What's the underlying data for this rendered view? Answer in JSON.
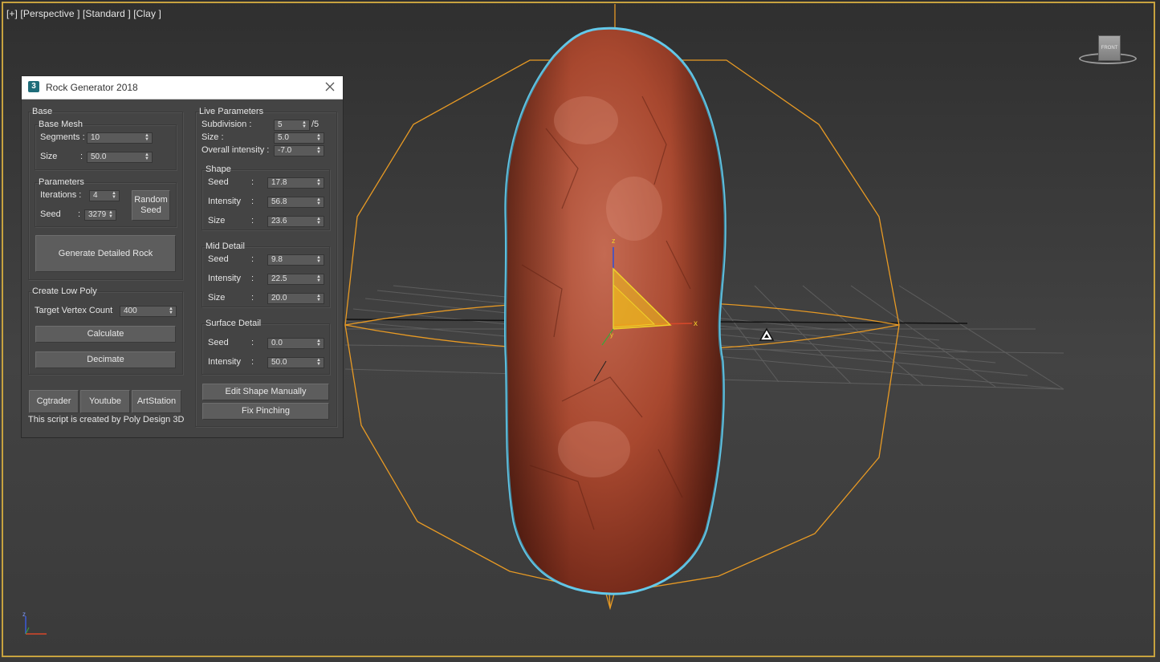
{
  "viewport": {
    "label_items": [
      "[+]",
      "[Perspective ]",
      "[Standard ]",
      "[Clay ]"
    ],
    "viewcube_label": "FRONT",
    "gizmo_x": "x",
    "gizmo_z": "z",
    "gizmo_y": "y",
    "tripod_z": "z",
    "colors": {
      "border": "#c7a23f",
      "selection_outline": "#63c9ea",
      "bounding_box": "#e89a24",
      "rock": "#a8482f"
    }
  },
  "dialog": {
    "title": "Rock Generator 2018",
    "base": {
      "label": "Base",
      "base_mesh": {
        "label": "Base Mesh",
        "segments_label": "Segments :",
        "segments_value": "10",
        "size_label": "Size",
        "size_colon": ":",
        "size_value": "50.0"
      },
      "parameters": {
        "label": "Parameters",
        "iterations_label": "Iterations :",
        "iterations_value": "4",
        "seed_label": "Seed",
        "seed_colon": ":",
        "seed_value": "3279",
        "random_seed_line1": "Random",
        "random_seed_line2": "Seed"
      },
      "generate_label": "Generate Detailed Rock"
    },
    "low_poly": {
      "label": "Create Low Poly",
      "target_label": "Target Vertex Count",
      "target_value": "400",
      "calculate_label": "Calculate",
      "decimate_label": "Decimate"
    },
    "links": {
      "cgtrader": "Cgtrader",
      "youtube": "Youtube",
      "artstation": "ArtStation"
    },
    "credit": "This script is created by Poly Design 3D",
    "live": {
      "label": "Live Parameters",
      "subdivision_label": "Subdivision :",
      "subdivision_value": "5",
      "subdivision_max": "/5",
      "size_label": "Size :",
      "size_value": "5.0",
      "overall_label": "Overall intensity :",
      "overall_value": "-7.0",
      "colon": ":",
      "shape": {
        "label": "Shape",
        "seed_label": "Seed",
        "seed_value": "17.8",
        "intensity_label": "Intensity",
        "intensity_value": "56.8",
        "size_label": "Size",
        "size_value": "23.6"
      },
      "mid": {
        "label": "Mid Detail",
        "seed_label": "Seed",
        "seed_value": "9.8",
        "intensity_label": "Intensity",
        "intensity_value": "22.5",
        "size_label": "Size",
        "size_value": "20.0"
      },
      "surface": {
        "label": "Surface Detail",
        "seed_label": "Seed",
        "seed_value": "0.0",
        "intensity_label": "Intensity",
        "intensity_value": "50.0"
      },
      "edit_shape_label": "Edit Shape Manually",
      "fix_pinching_label": "Fix Pinching"
    }
  }
}
